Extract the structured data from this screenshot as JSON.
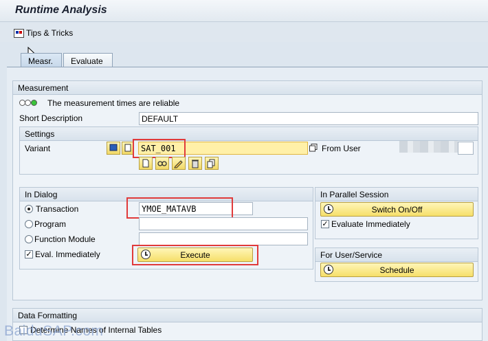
{
  "window": {
    "title": "Runtime Analysis"
  },
  "toolbar": {
    "tips_label": "Tips & Tricks"
  },
  "tabs": [
    {
      "label": "Measr.",
      "active": true
    },
    {
      "label": "Evaluate",
      "active": false
    }
  ],
  "measurement": {
    "header": "Measurement",
    "status_text": "The measurement times are reliable",
    "short_desc_label": "Short Description",
    "short_desc_value": "DEFAULT"
  },
  "settings": {
    "header": "Settings",
    "variant_label": "Variant",
    "variant_value": "SAT_001",
    "from_user_label": "From User"
  },
  "in_dialog": {
    "header": "In Dialog",
    "transaction_label": "Transaction",
    "transaction_value": "YMOE_MATAVB",
    "program_label": "Program",
    "function_module_label": "Function Module",
    "eval_label": "Eval. Immediately",
    "execute_label": "Execute"
  },
  "parallel": {
    "header": "In Parallel Session",
    "switch_label": "Switch On/Off",
    "eval_label": "Evaluate Immediately"
  },
  "user_service": {
    "header": "For User/Service",
    "schedule_label": "Schedule"
  },
  "data_formatting": {
    "header": "Data Formatting",
    "determine_label": "Determine Names of Internal Tables"
  },
  "watermark": "BaiduSAP.com",
  "colors": {
    "highlight": "#e03a3a",
    "input_required": "#fff0a8",
    "button": "#f6df6a",
    "led_green": "#3ac43a"
  },
  "icons": [
    "tips-icon",
    "led-traffic-light-icon",
    "clock-icon",
    "create-icon",
    "glasses-icon",
    "pencil-icon",
    "trash-icon",
    "copy-icon",
    "multi-select-icon"
  ]
}
